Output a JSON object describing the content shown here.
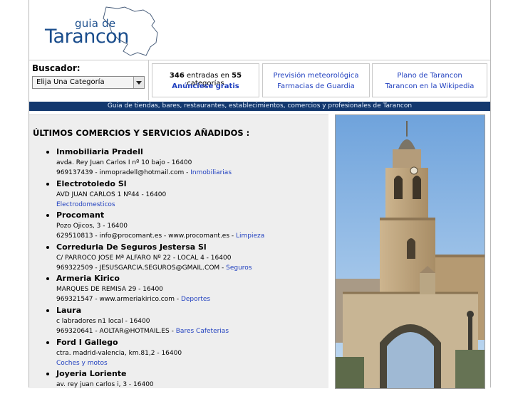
{
  "logo": {
    "small": "guia de",
    "big": "Tarancon"
  },
  "buscador": {
    "label": "Buscador:",
    "selected": "Elija Una Categoría"
  },
  "stats": {
    "entries": "346",
    "text_mid": " entradas en ",
    "categories": "55",
    "text_end": " categorías",
    "advertise": "Anúnciese gratis"
  },
  "links_mid": {
    "weather": "Previsión meteorológica",
    "pharmacies": "Farmacias de Guardia"
  },
  "links_right": {
    "map": "Plano de Tarancon",
    "wiki": "Tarancon en la Wikipedia"
  },
  "banner": "Guia de tiendas, bares, restaurantes, establecimientos, comercios y profesionales de Tarancon",
  "section_title": "ÚLTIMOS COMERCIOS Y SERVICIOS AÑADIDOS :",
  "listings": [
    {
      "name": "Inmobiliaria Pradell",
      "address": "avda. Rey Juan Carlos I nº 10 bajo - 16400",
      "contact": "969137439 - inmopradell@hotmail.com - ",
      "category": "Inmobiliarias"
    },
    {
      "name": "Electrotoledo Sl",
      "address": "AVD JUAN CARLOS 1 Nº44 - 16400",
      "contact": "",
      "category": "Electrodomesticos"
    },
    {
      "name": "Procomant",
      "address": "Pozo Ojicos, 3 - 16400",
      "contact": "629510813 - info@procomant.es - www.procomant.es - ",
      "category": "Limpieza"
    },
    {
      "name": "Correduria De Seguros Jestersa Sl",
      "address": "C/ PARROCO JOSE Mª ALFARO Nº 22 - LOCAL 4 - 16400",
      "contact": "969322509 - JESUSGARCIA.SEGUROS@GMAIL.COM - ",
      "category": "Seguros"
    },
    {
      "name": "Armeria Kirico",
      "address": "MARQUES DE REMISA 29 - 16400",
      "contact": "969321547 - www.armeriakirico.com - ",
      "category": "Deportes"
    },
    {
      "name": "Laura",
      "address": "c labradores n1 local - 16400",
      "contact": "969320641 - AOLTAR@HOTMAIL.ES - ",
      "category": "Bares Cafeterias"
    },
    {
      "name": "Ford I Gallego",
      "address": "ctra. madrid-valencia, km.81,2 - 16400",
      "contact": "",
      "category": "Coches y motos"
    },
    {
      "name": "Joyeria Loriente",
      "address": "av. rey juan carlos i, 3 - 16400",
      "contact": "",
      "category": ""
    }
  ]
}
